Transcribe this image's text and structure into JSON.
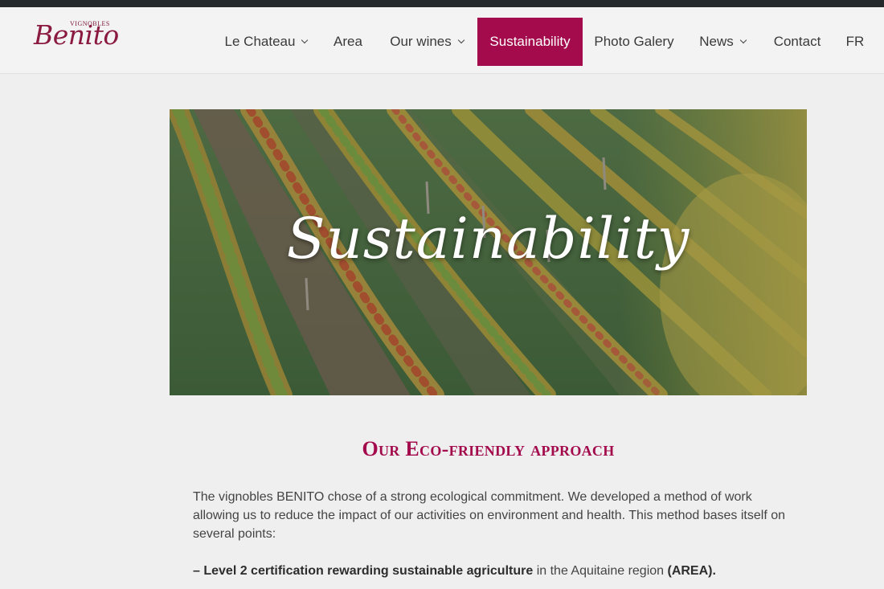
{
  "logo": {
    "small": "VIGNOBLES",
    "big": "Benito"
  },
  "nav": {
    "items": [
      {
        "label": "Le Chateau",
        "dropdown": true
      },
      {
        "label": "Area",
        "dropdown": false
      },
      {
        "label": "Our wines",
        "dropdown": true
      },
      {
        "label": "Sustainability",
        "dropdown": false,
        "active": true
      },
      {
        "label": "Photo Galery",
        "dropdown": false
      },
      {
        "label": "News",
        "dropdown": true
      },
      {
        "label": "Contact",
        "dropdown": false
      },
      {
        "label": "FR",
        "dropdown": false
      }
    ]
  },
  "hero": {
    "title": "Sustainability"
  },
  "section": {
    "title": "Our Eco-friendly approach",
    "intro": "The vignobles BENITO chose of a strong ecological commitment. We developed a method of work allowing us to reduce the impact of our activities on environment and health. This method bases itself on several points:",
    "point1_strong": "– Level 2 certification rewarding sustainable agriculture",
    "point1_text": " in the Aquitaine region ",
    "point1_strong2": "(AREA)."
  },
  "colors": {
    "accent": "#a30b4d",
    "topbar": "#26292c",
    "background": "#efefef"
  }
}
